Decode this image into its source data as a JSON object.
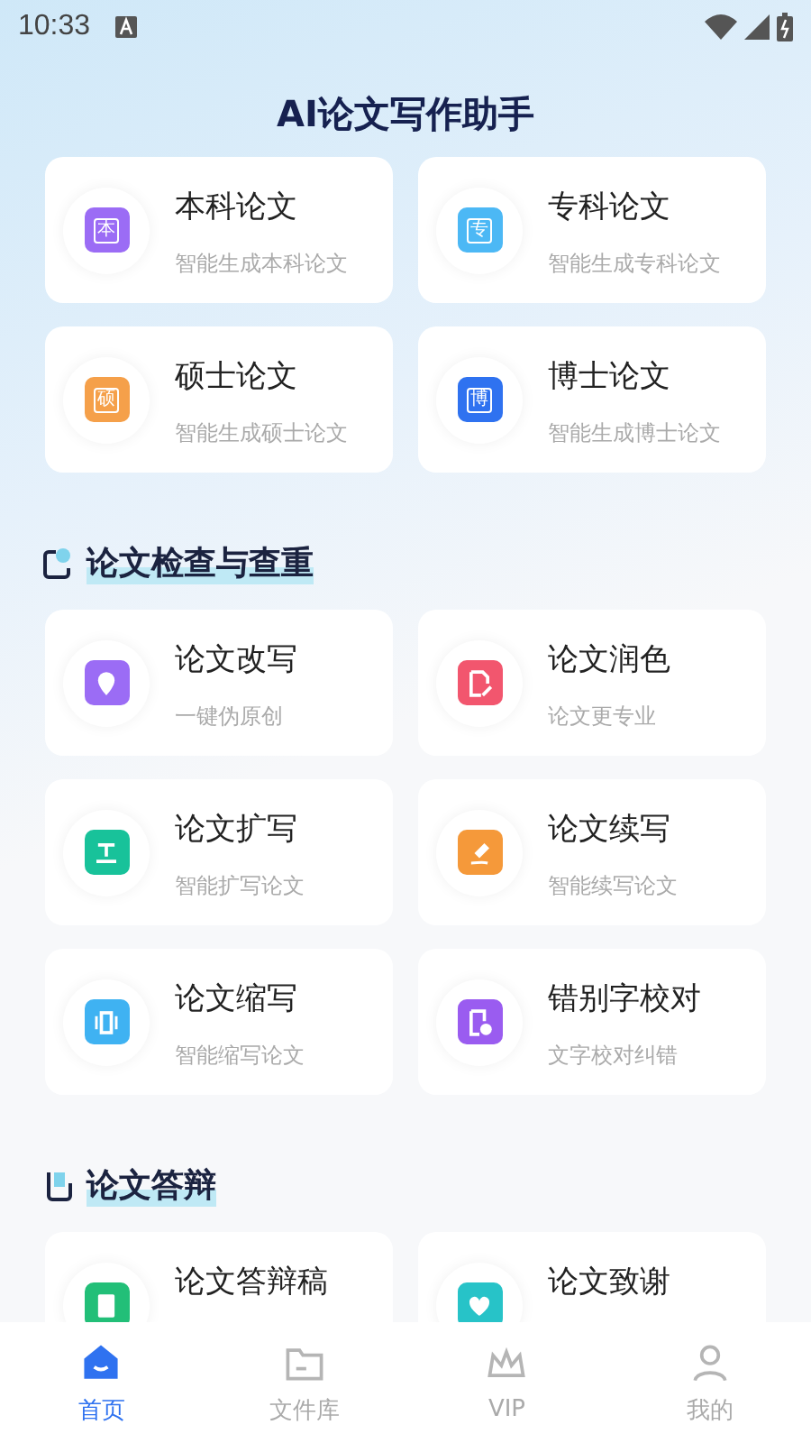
{
  "status_bar": {
    "time": "10:33"
  },
  "title": "AI论文写作助手",
  "top_cards": [
    {
      "title": "本科论文",
      "subtitle": "智能生成本科论文",
      "badge": "本",
      "color": "#9b6cf5"
    },
    {
      "title": "专科论文",
      "subtitle": "智能生成专科论文",
      "badge": "专",
      "color": "#4cb8f5"
    },
    {
      "title": "硕士论文",
      "subtitle": "智能生成硕士论文",
      "badge": "硕",
      "color": "#f5a04a"
    },
    {
      "title": "博士论文",
      "subtitle": "智能生成博士论文",
      "badge": "博",
      "color": "#2f72f0"
    }
  ],
  "sections": [
    {
      "heading": "论文检查与查重",
      "kind": "check",
      "cards": [
        {
          "title": "论文改写",
          "subtitle": "一键伪原创",
          "kind": "pin",
          "color": "#9b6cf5"
        },
        {
          "title": "论文润色",
          "subtitle": "论文更专业",
          "kind": "doc-pen",
          "color": "#f2566e"
        },
        {
          "title": "论文扩写",
          "subtitle": "智能扩写论文",
          "kind": "expand",
          "color": "#18c29a"
        },
        {
          "title": "论文续写",
          "subtitle": "智能续写论文",
          "kind": "brush",
          "color": "#f5993a"
        },
        {
          "title": "论文缩写",
          "subtitle": "智能缩写论文",
          "kind": "shrink",
          "color": "#3fb2f2"
        },
        {
          "title": "错别字校对",
          "subtitle": "文字校对纠错",
          "kind": "doc-check",
          "color": "#9a5cf0"
        }
      ]
    },
    {
      "heading": "论文答辩",
      "kind": "book",
      "cards": [
        {
          "title": "论文答辩稿",
          "kind": "doc",
          "color": "#22bf78"
        },
        {
          "title": "论文致谢",
          "kind": "heart",
          "color": "#27c3c8"
        }
      ]
    }
  ],
  "nav": [
    {
      "label": "首页",
      "kind": "home",
      "selected": true
    },
    {
      "label": "文件库",
      "kind": "folder",
      "selected": false
    },
    {
      "label": "VIP",
      "kind": "crown",
      "selected": false
    },
    {
      "label": "我的",
      "kind": "person",
      "selected": false
    }
  ]
}
